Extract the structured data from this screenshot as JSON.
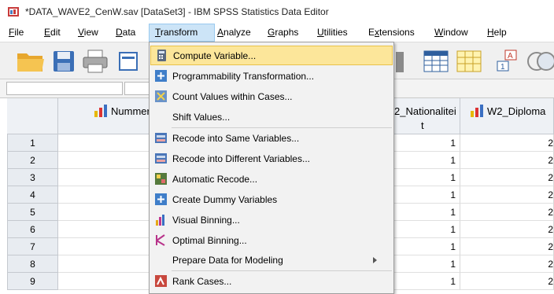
{
  "window": {
    "title": "*DATA_WAVE2_CenW.sav [DataSet3] - IBM SPSS Statistics Data Editor"
  },
  "menubar": {
    "items": [
      {
        "label": "File",
        "u": "F",
        "rest": "ile"
      },
      {
        "label": "Edit",
        "u": "E",
        "rest": "dit"
      },
      {
        "label": "View",
        "u": "V",
        "rest": "iew"
      },
      {
        "label": "Data",
        "u": "D",
        "rest": "ata"
      },
      {
        "label": "Transform",
        "u": "T",
        "rest": "ransform"
      },
      {
        "label": "Analyze",
        "u": "A",
        "rest": "nalyze"
      },
      {
        "label": "Graphs",
        "u": "G",
        "rest": "raphs"
      },
      {
        "label": "Utilities",
        "u": "U",
        "rest": "tilities"
      },
      {
        "label": "Extensions",
        "u": "x",
        "pre": "E",
        "rest": "tensions"
      },
      {
        "label": "Window",
        "u": "W",
        "rest": "indow"
      },
      {
        "label": "Help",
        "u": "H",
        "rest": "elp"
      }
    ]
  },
  "transform_menu": {
    "items": [
      {
        "label": "Compute Variable...",
        "icon": "calculator-icon",
        "highlighted": true
      },
      {
        "label": "Programmability Transformation...",
        "icon": "plus-icon"
      },
      {
        "label": "Count Values within Cases...",
        "icon": "count-icon"
      },
      {
        "label": "Shift Values...",
        "icon": ""
      },
      {
        "label": "Recode into Same Variables...",
        "icon": "recode-icon"
      },
      {
        "label": "Recode into Different Variables...",
        "icon": "recode-icon"
      },
      {
        "label": "Automatic Recode...",
        "icon": "auto-recode-icon"
      },
      {
        "label": "Create Dummy Variables",
        "icon": "plus-icon"
      },
      {
        "label": "Visual Binning...",
        "icon": "binning-icon"
      },
      {
        "label": "Optimal Binning...",
        "icon": "optimal-binning-icon"
      },
      {
        "label": "Prepare Data for Modeling",
        "icon": "",
        "submenu": true
      },
      {
        "label": "Rank Cases...",
        "icon": "rank-icon"
      }
    ]
  },
  "grid": {
    "columns": [
      {
        "name": "Nummer"
      },
      {
        "name_line1": "2_Nationalitei",
        "name_line2": "t"
      },
      {
        "name": "W2_Diploma"
      }
    ],
    "row_numbers": [
      "1",
      "2",
      "3",
      "4",
      "5",
      "6",
      "7",
      "8",
      "9"
    ],
    "nationaliteit_values": [
      "1",
      "1",
      "1",
      "1",
      "1",
      "1",
      "1",
      "1",
      "1"
    ],
    "diploma_values": [
      "2",
      "2",
      "2",
      "2",
      "2",
      "2",
      "2",
      "2",
      "2"
    ]
  },
  "colors": {
    "highlight": "#fce69a",
    "menu_active": "#cce4f7",
    "header_bg": "#eef1f5"
  }
}
